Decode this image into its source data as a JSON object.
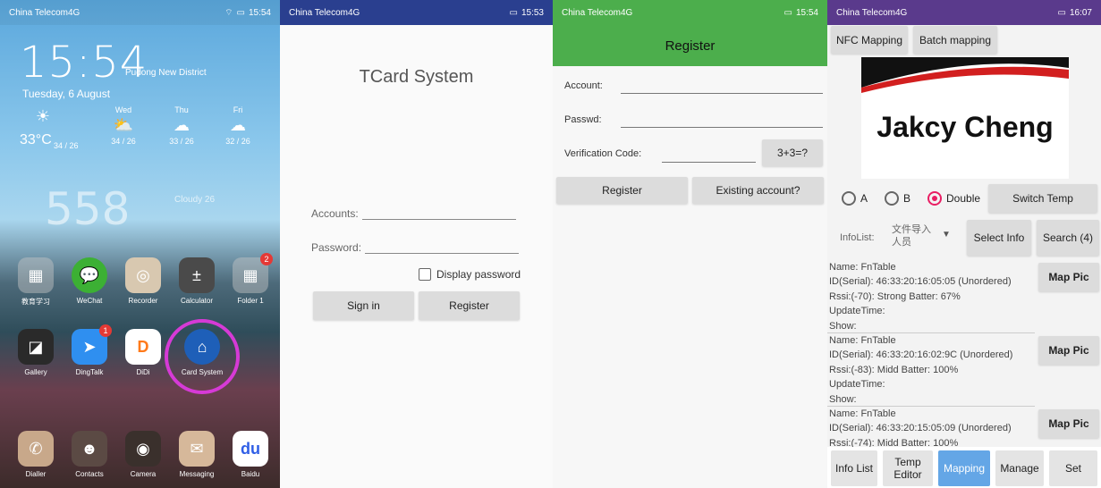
{
  "home": {
    "status": {
      "carrier": "China Telecom4G",
      "time": "15:54"
    },
    "clock": "15:54",
    "district": "Pudong New District",
    "date": "Tuesday, 6 August",
    "weather": {
      "now_temp": "33°C",
      "now_range": "34 / 26",
      "forecast": [
        {
          "day": "Wed",
          "range": "34 / 26",
          "icon": "partly-cloudy-icon"
        },
        {
          "day": "Thu",
          "range": "33 / 26",
          "icon": "cloud-icon"
        },
        {
          "day": "Fri",
          "range": "32 / 26",
          "icon": "cloud-icon"
        }
      ]
    },
    "big_clock": "558",
    "big_clock_note": "Cloudy 26",
    "apps_row1": [
      {
        "label": "教育学习",
        "icon": "folder-icon"
      },
      {
        "label": "WeChat",
        "icon": "wechat-icon"
      },
      {
        "label": "Recorder",
        "icon": "microphone-icon"
      },
      {
        "label": "Calculator",
        "icon": "calculator-icon"
      },
      {
        "label": "Folder 1",
        "icon": "folder-icon",
        "badge": "2"
      }
    ],
    "apps_row2": [
      {
        "label": "Gallery",
        "icon": "gallery-icon"
      },
      {
        "label": "DingTalk",
        "icon": "dingtalk-icon",
        "badge": "1"
      },
      {
        "label": "DiDi",
        "icon": "didi-icon"
      },
      {
        "label": "Card System",
        "icon": "card-system-icon"
      }
    ],
    "dock": [
      {
        "label": "Dialler",
        "icon": "phone-icon"
      },
      {
        "label": "Contacts",
        "icon": "contacts-icon"
      },
      {
        "label": "Camera",
        "icon": "camera-icon"
      },
      {
        "label": "Messaging",
        "icon": "message-icon"
      },
      {
        "label": "Baidu",
        "icon": "baidu-icon"
      }
    ]
  },
  "login": {
    "status": {
      "carrier": "China Telecom4G",
      "time": "15:53"
    },
    "title": "TCard System",
    "accounts_label": "Accounts:",
    "password_label": "Password:",
    "display_password": "Display password",
    "sign_in": "Sign in",
    "register": "Register"
  },
  "register": {
    "status": {
      "carrier": "China Telecom4G",
      "time": "15:54"
    },
    "header": "Register",
    "account_label": "Account:",
    "passwd_label": "Passwd:",
    "verification_label": "Verification Code:",
    "captcha": "3+3=?",
    "register_btn": "Register",
    "existing_btn": "Existing account?"
  },
  "mapping": {
    "status": {
      "carrier": "China Telecom4G",
      "time": "16:07"
    },
    "nfc_btn": "NFC Mapping",
    "batch_btn": "Batch mapping",
    "card_name": "Jakcy Cheng",
    "radio_a": "A",
    "radio_b": "B",
    "radio_double": "Double",
    "switch_temp": "Switch Temp",
    "infolist_label": "InfoList:",
    "infolist_value": "文件导入人员",
    "select_info": "Select Info",
    "search": "Search (4)",
    "map_pic": "Map Pic",
    "items": [
      {
        "name": "Name: FnTable",
        "id": "ID(Serial): 46:33:20:16:05:05 (Unordered)",
        "rssi": "Rssi:(-70): Strong   Batter: 67%",
        "update": "UpdateTime:",
        "show": "Show:"
      },
      {
        "name": "Name: FnTable",
        "id": "ID(Serial): 46:33:20:16:02:9C (Unordered)",
        "rssi": "Rssi:(-83): Midd   Batter: 100%",
        "update": "UpdateTime:",
        "show": "Show:"
      },
      {
        "name": "Name: FnTable",
        "id": "ID(Serial): 46:33:20:15:05:09 (Unordered)",
        "rssi": "Rssi:(-74): Midd   Batter: 100%",
        "update": "",
        "show": ""
      }
    ],
    "tabs": [
      "Info List",
      "Temp Editor",
      "Mapping",
      "Manage",
      "Set"
    ]
  }
}
